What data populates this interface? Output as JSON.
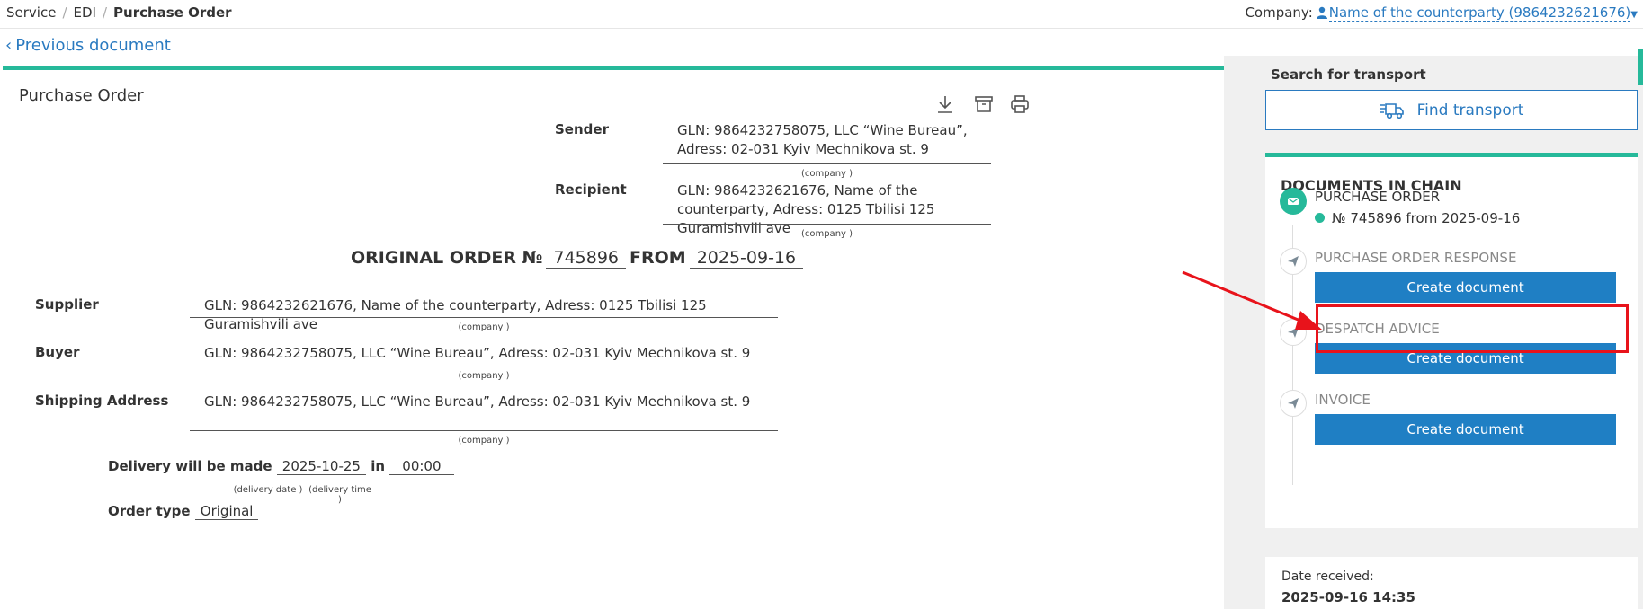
{
  "breadcrumb": {
    "service": "Service",
    "edi": "EDI",
    "current": "Purchase Order"
  },
  "company": {
    "label": "Company:",
    "name": "Name of the counterparty (9864232621676)"
  },
  "prev_doc": "Previous document",
  "document": {
    "title": "Purchase Order",
    "sender_label": "Sender",
    "sender_value": "GLN: 9864232758075, LLC “Wine Bureau”, Adress: 02-031 Kyiv Mechnikova st. 9",
    "recipient_label": "Recipient",
    "recipient_value": "GLN: 9864232621676, Name of the counterparty, Adress: 0125 Tbilisi 125 Guramishvili ave",
    "company_hint": "(company )",
    "order_prefix": "ORIGINAL ORDER №",
    "order_number": "745896",
    "order_from": "FROM",
    "order_date": "2025-09-16",
    "supplier_label": "Supplier",
    "supplier_value": "GLN: 9864232621676, Name of the counterparty, Adress: 0125 Tbilisi 125 Guramishvili ave",
    "buyer_label": "Buyer",
    "buyer_value": "GLN: 9864232758075, LLC “Wine Bureau”, Adress: 02-031 Kyiv Mechnikova st. 9",
    "shipping_label": "Shipping Address",
    "shipping_value": "GLN: 9864232758075, LLC “Wine Bureau”, Adress: 02-031 Kyiv Mechnikova st. 9",
    "delivery_label": "Delivery will be made",
    "delivery_date": "2025-10-25",
    "delivery_in": "in",
    "delivery_time": "00:00",
    "delivery_date_hint": "(delivery date )",
    "delivery_time_hint": "(delivery time )",
    "order_type_label": "Order type",
    "order_type_value": "Original"
  },
  "transport": {
    "label": "Search for transport",
    "button": "Find transport"
  },
  "chain": {
    "title": "DOCUMENTS IN CHAIN",
    "steps": [
      {
        "title": "PURCHASE ORDER",
        "doc": "№ 745896 from 2025-09-16"
      },
      {
        "title": "PURCHASE ORDER RESPONSE",
        "button": "Create document"
      },
      {
        "title": "DESPATCH ADVICE",
        "button": "Create document"
      },
      {
        "title": "INVOICE",
        "button": "Create document"
      }
    ]
  },
  "received": {
    "label": "Date received:",
    "value": "2025-09-16 14:35"
  },
  "colors": {
    "accent": "#26b99a",
    "primary": "#1f7fc4",
    "link": "#2a7ac0",
    "highlight": "#e8131b"
  }
}
